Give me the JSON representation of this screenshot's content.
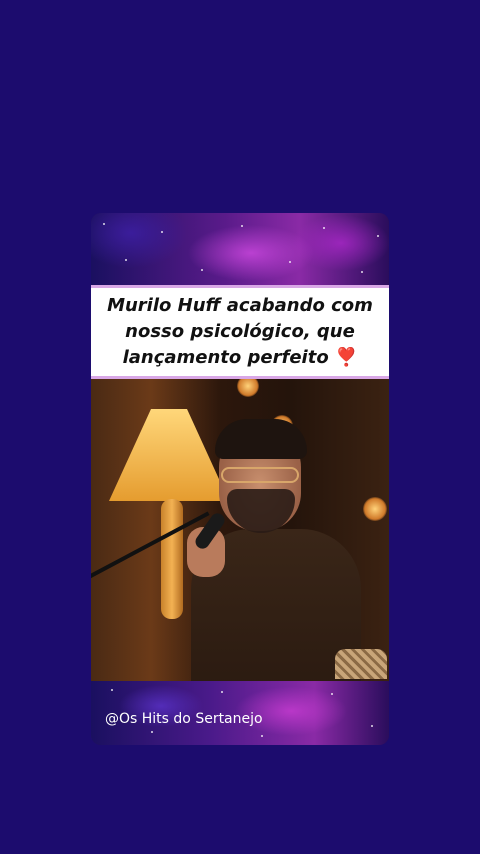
{
  "post": {
    "caption_line1": "Murilo Huff acabando com",
    "caption_line2": "nosso psicológico, que",
    "caption_line3": "lançamento perfeito",
    "caption_emoji": "❣️",
    "watermark": "@Os Hits do Sertanejo",
    "photo_icon": "singer-photo"
  },
  "colors": {
    "background": "#1c0c6e",
    "accent": "#d9a7e6",
    "caption_text": "#111111",
    "heart": "#e0344f"
  }
}
